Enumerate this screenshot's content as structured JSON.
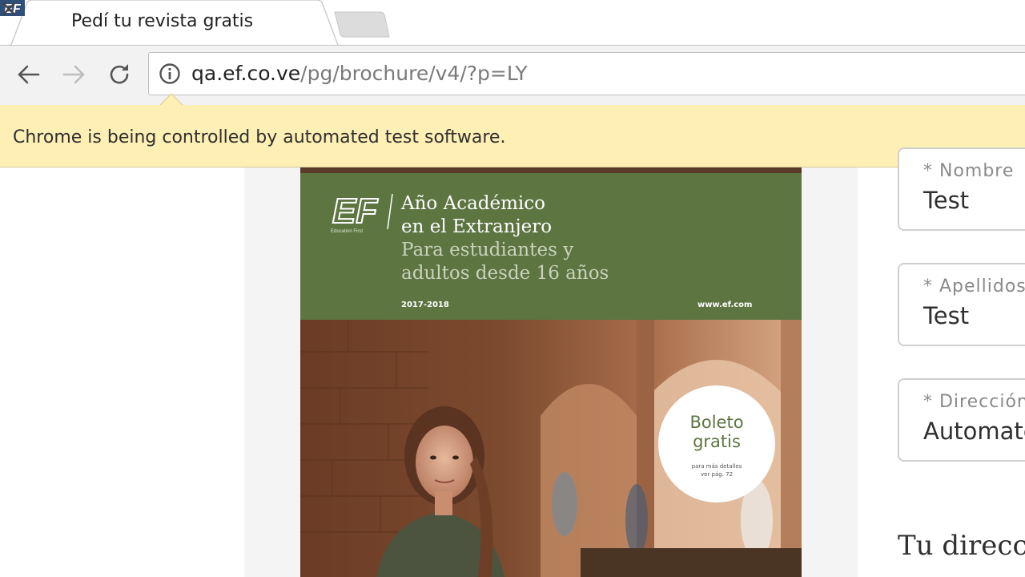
{
  "browser": {
    "tab": {
      "title": "Pedí tu revista gratis",
      "favicon": "ef-favicon-icon",
      "close_icon": "close-icon"
    },
    "toolbar": {
      "back_icon": "arrow-left-icon",
      "forward_icon": "arrow-right-icon",
      "reload_icon": "reload-icon",
      "site_info_icon": "info-icon",
      "url_host": "qa.ef.co.ve",
      "url_path": "/pg/brochure/v4/?p=LY"
    },
    "infobar": {
      "message": "Chrome is being controlled by automated test software."
    }
  },
  "brochure": {
    "logo_text": "EF",
    "logo_caption": "Education First",
    "title_line1": "Año Académico",
    "title_line2": "en el Extranjero",
    "subtitle_line1": "Para estudiantes y",
    "subtitle_line2": "adultos desde 16 años",
    "year": "2017-2018",
    "site": "www.ef.com",
    "badge_line1": "Boleto",
    "badge_line2": "gratis",
    "badge_note_line1": "para más detalles",
    "badge_note_line2": "ver pág. 72",
    "header_color": "#5c7541"
  },
  "form": {
    "fields": [
      {
        "label": "* Nombre",
        "value": "Test"
      },
      {
        "label": "* Apellidos",
        "value": "Test"
      },
      {
        "label": "* Dirección",
        "value": "Automate"
      }
    ],
    "address_heading": "Tu direcció"
  }
}
